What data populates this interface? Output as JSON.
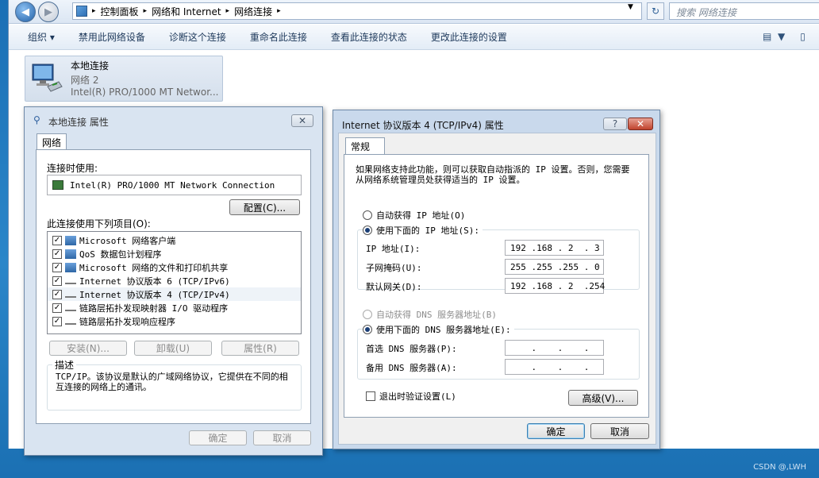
{
  "explorer": {
    "breadcrumb": [
      "控制面板",
      "网络和 Internet",
      "网络连接"
    ],
    "search_placeholder": "搜索 网络连接",
    "commands": [
      "组织 ▾",
      "禁用此网络设备",
      "诊断这个连接",
      "重命名此连接",
      "查看此连接的状态",
      "更改此连接的设置"
    ],
    "item": {
      "name": "本地连接",
      "network": "网络  2",
      "adapter": "Intel(R) PRO/1000 MT Networ..."
    }
  },
  "props_dialog": {
    "title": "本地连接 属性",
    "tab": "网络",
    "connect_using_label": "连接时使用:",
    "adapter": "Intel(R) PRO/1000 MT Network Connection",
    "configure_btn": "配置(C)...",
    "items_label": "此连接使用下列项目(O):",
    "items": [
      {
        "label": "Microsoft 网络客户端",
        "checked": true
      },
      {
        "label": "QoS 数据包计划程序",
        "checked": true
      },
      {
        "label": "Microsoft 网络的文件和打印机共享",
        "checked": true
      },
      {
        "label": "Internet 协议版本 6 (TCP/IPv6)",
        "checked": true
      },
      {
        "label": "Internet 协议版本 4 (TCP/IPv4)",
        "checked": true
      },
      {
        "label": "链路层拓扑发现映射器 I/O 驱动程序",
        "checked": true
      },
      {
        "label": "链路层拓扑发现响应程序",
        "checked": true
      }
    ],
    "install_btn": "安装(N)...",
    "uninstall_btn": "卸载(U)",
    "properties_btn": "属性(R)",
    "description_label": "描述",
    "description": "TCP/IP。该协议是默认的广域网络协议，它提供在不同的相互连接的网络上的通讯。",
    "ok_btn": "确定",
    "cancel_btn": "取消"
  },
  "ipv4_dialog": {
    "title": "Internet 协议版本 4 (TCP/IPv4) 属性",
    "help": "?",
    "tab": "常规",
    "intro": "如果网络支持此功能，则可以获取自动指派的 IP 设置。否则，您需要从网络系统管理员处获得适当的 IP 设置。",
    "auto_ip": "自动获得 IP 地址(O)",
    "manual_ip": "使用下面的 IP 地址(S):",
    "ip_label": "IP 地址(I):",
    "ip_value": "192 .168 . 2  . 3",
    "mask_label": "子网掩码(U):",
    "mask_value": "255 .255 .255 . 0",
    "gateway_label": "默认网关(D):",
    "gateway_value": "192 .168 . 2  .254",
    "auto_dns": "自动获得 DNS 服务器地址(B)",
    "manual_dns": "使用下面的 DNS 服务器地址(E):",
    "dns1_label": "首选 DNS 服务器(P):",
    "dns1_value": "    .    .    .",
    "dns2_label": "备用 DNS 服务器(A):",
    "dns2_value": "    .    .    .",
    "validate_label": "退出时验证设置(L)",
    "advanced_btn": "高级(V)...",
    "ok_btn": "确定",
    "cancel_btn": "取消"
  },
  "watermark": "CSDN @,LWH"
}
